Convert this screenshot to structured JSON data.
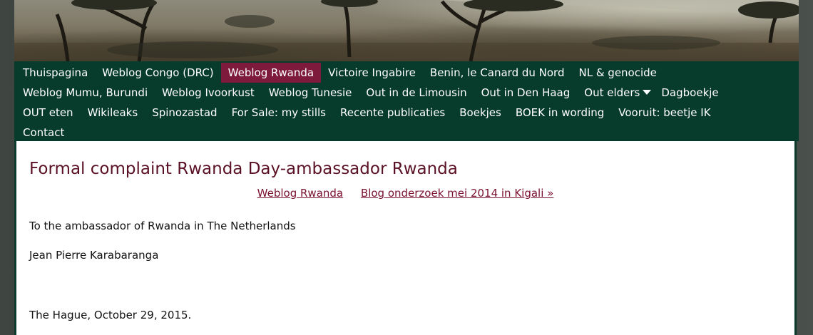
{
  "nav": {
    "row1": [
      {
        "label": "Thuispagina"
      },
      {
        "label": "Weblog Congo (DRC)"
      },
      {
        "label": "Weblog Rwanda",
        "active": true
      },
      {
        "label": "Victoire Ingabire"
      },
      {
        "label": "Benin, le Canard du Nord"
      },
      {
        "label": "NL & genocide"
      }
    ],
    "row2": [
      {
        "label": "Weblog Mumu, Burundi"
      },
      {
        "label": "Weblog Ivoorkust"
      },
      {
        "label": "Weblog Tunesie"
      },
      {
        "label": "Out in de Limousin"
      },
      {
        "label": "Out in Den Haag"
      },
      {
        "label": "Out elders",
        "dropdown": true
      },
      {
        "label": "Dagboekje"
      }
    ],
    "row3": [
      {
        "label": "OUT eten"
      },
      {
        "label": "Wikileaks"
      },
      {
        "label": "Spinozastad"
      },
      {
        "label": "For Sale: my stills"
      },
      {
        "label": "Recente publicaties"
      },
      {
        "label": "Boekjes"
      },
      {
        "label": "BOEK in wording"
      },
      {
        "label": "Vooruit: beetje IK"
      }
    ],
    "row4": [
      {
        "label": "Contact"
      }
    ]
  },
  "post": {
    "title": "Formal complaint Rwanda Day-ambassador Rwanda",
    "category_link": "Weblog Rwanda",
    "next_link": "Blog onderzoek mei 2014 in Kigali »",
    "para1": "To the ambassador of Rwanda in The Netherlands",
    "para2": "Jean Pierre Karabaranga",
    "para3": "The Hague, October 29, 2015."
  },
  "colors": {
    "nav_bg": "#073b2c",
    "nav_active": "#7e1a3b",
    "title": "#5b1125",
    "link": "#7a1030"
  }
}
